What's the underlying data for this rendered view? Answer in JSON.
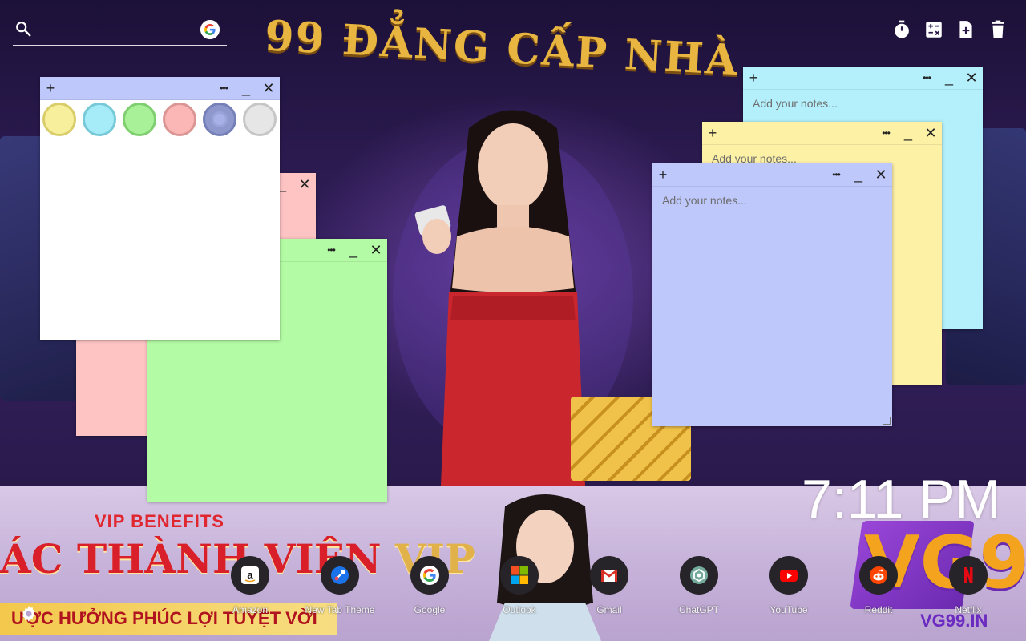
{
  "search": {
    "placeholder": "",
    "value": ""
  },
  "toolbar": {
    "icons": [
      "timer-icon",
      "calculator-icon",
      "new-note-icon",
      "trash-icon"
    ]
  },
  "notes": [
    {
      "color": "#b3f0fb",
      "placeholder": "Add your notes...",
      "value": ""
    },
    {
      "color": "#fdf1a6",
      "placeholder": "Add your notes...",
      "value": ""
    },
    {
      "color": "#bfc8fb",
      "placeholder": "Add your notes...",
      "value": ""
    },
    {
      "color": "#fec4c4",
      "value": ""
    },
    {
      "color": "#b3fba4",
      "value": ""
    },
    {
      "color": "#ffffff",
      "value": ""
    }
  ],
  "note_controls": {
    "add": "+",
    "more": "•••",
    "minimize": "_",
    "close": "✕"
  },
  "color_palette": [
    "#f8ef9c",
    "#a6ecf8",
    "#a9f199",
    "#fbb6b6",
    "#8e98cc",
    "#e6e6e6"
  ],
  "wallpaper": {
    "title": "99 ĐẲNG CẤP NHÀ",
    "vip_benefits": "VIP BENEFITS",
    "members": "ÁC THÀNH VIÊN",
    "vip": "VIP",
    "sub": "ƯỢC HƯỞNG PHÚC LỢI TUYỆT VỜI",
    "logo": "VG9",
    "logo_small": "VG99.IN"
  },
  "clock": {
    "time": "7:11 PM"
  },
  "shortcuts": [
    {
      "label": "Amazon",
      "icon": "amazon-icon"
    },
    {
      "label": "New Tab Theme",
      "icon": "new-tab-theme-icon"
    },
    {
      "label": "Google",
      "icon": "google-icon"
    },
    {
      "label": "Outlook",
      "icon": "outlook-icon"
    },
    {
      "label": "Gmail",
      "icon": "gmail-icon"
    },
    {
      "label": "ChatGPT",
      "icon": "chatgpt-icon"
    },
    {
      "label": "YouTube",
      "icon": "youtube-icon"
    },
    {
      "label": "Reddit",
      "icon": "reddit-icon"
    },
    {
      "label": "Netflix",
      "icon": "netflix-icon"
    }
  ]
}
